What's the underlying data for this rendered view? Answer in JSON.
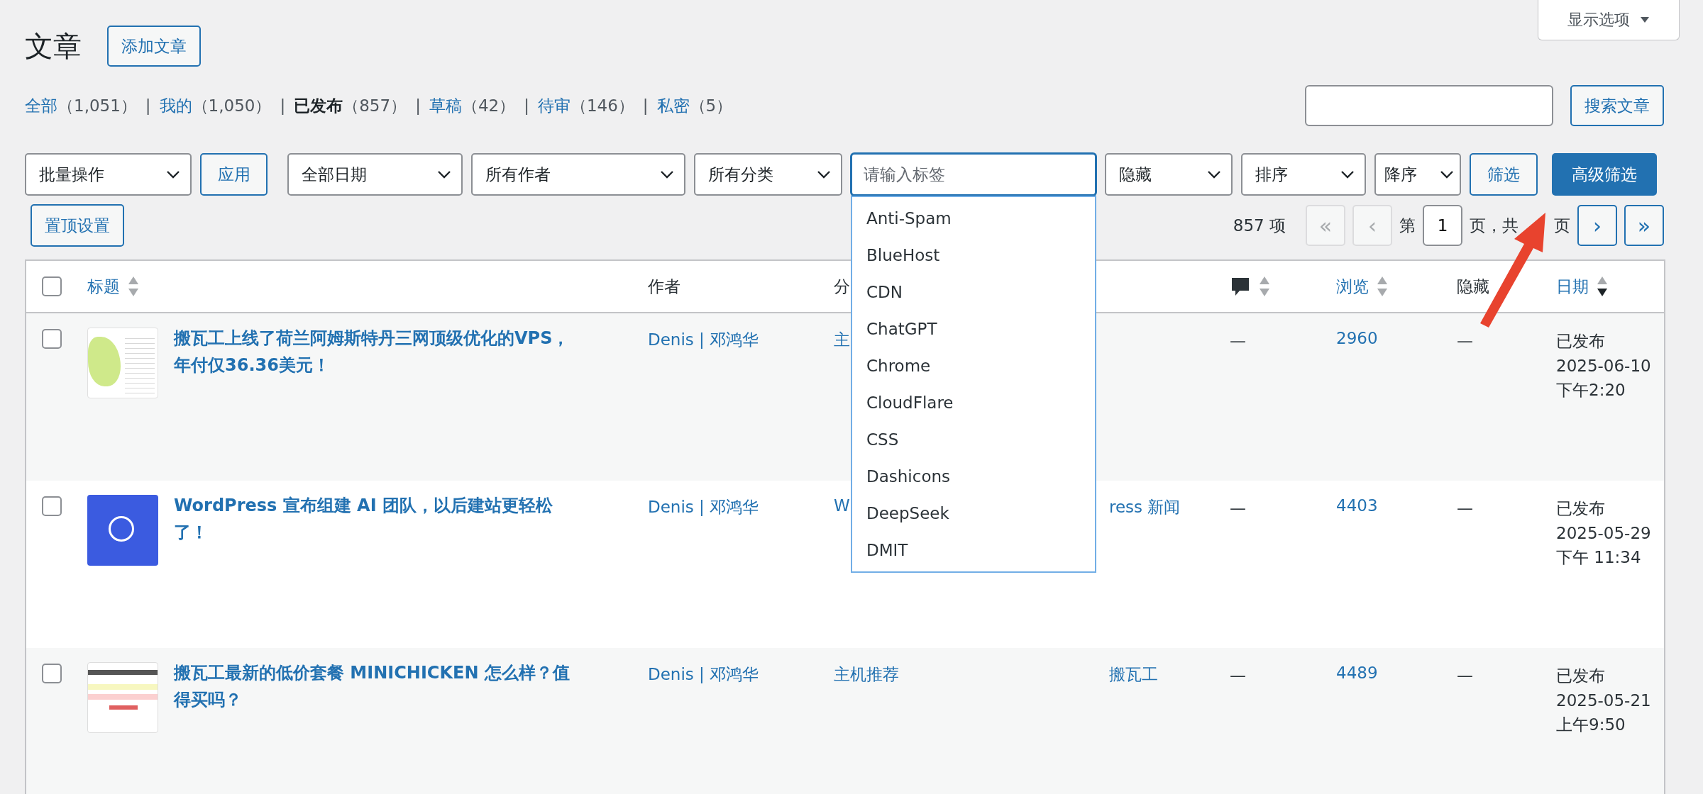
{
  "header": {
    "title": "文章",
    "add_button": "添加文章",
    "screen_options": "显示选项"
  },
  "status_links": [
    {
      "label": "全部",
      "count": "（1,051）",
      "separator": "|",
      "selected": false
    },
    {
      "label": "我的",
      "count": "（1,050）",
      "separator": "|",
      "selected": false
    },
    {
      "label": "已发布",
      "count": "（857）",
      "separator": "|",
      "selected": true
    },
    {
      "label": "草稿",
      "count": "（42）",
      "separator": "|",
      "selected": false
    },
    {
      "label": "待审",
      "count": "（146）",
      "separator": "|",
      "selected": false
    },
    {
      "label": "私密",
      "count": "（5）",
      "selected": false
    }
  ],
  "search": {
    "button": "搜索文章"
  },
  "filters": [
    {
      "kind": "select",
      "value": "批量操作"
    },
    {
      "kind": "button",
      "label": "应用"
    },
    {
      "kind": "select",
      "value": "全部日期"
    },
    {
      "kind": "select",
      "value": "所有作者"
    },
    {
      "kind": "select",
      "value": "所有分类"
    },
    {
      "kind": "tag_input",
      "placeholder": "请输入标签",
      "suggestions": [
        "Anti-Spam",
        "BlueHost",
        "CDN",
        "ChatGPT",
        "Chrome",
        "CloudFlare",
        "CSS",
        "Dashicons",
        "DeepSeek",
        "DMIT"
      ]
    },
    {
      "kind": "select",
      "value": "隐藏"
    },
    {
      "kind": "select",
      "value": "排序"
    },
    {
      "kind": "select",
      "value": "降序"
    },
    {
      "kind": "button",
      "label": "筛选"
    },
    {
      "kind": "primary",
      "label": "高级筛选"
    }
  ],
  "sticky_button": "置顶设置",
  "pagination": {
    "count": "857 项",
    "buttons_before": [
      {
        "label": "«",
        "disabled": true
      },
      {
        "label": "‹",
        "disabled": true
      }
    ],
    "page_label": "第",
    "page": "1",
    "of_label": "页，共",
    "page_suffix": "页",
    "buttons_after": [
      {
        "label": "›",
        "disabled": false
      },
      {
        "label": "»",
        "disabled": false
      }
    ]
  },
  "table": {
    "columns": [
      {
        "kind": "checkbox",
        "checked": false
      },
      {
        "kind": "text",
        "label": "标题",
        "link": true,
        "sortable": true,
        "sorted_desc": false
      },
      {
        "kind": "text",
        "label": "作者",
        "link": false,
        "sortable": false
      },
      {
        "kind": "text",
        "label": "分",
        "link": false,
        "sortable": false
      },
      {
        "kind": "empty"
      },
      {
        "kind": "comment_icon",
        "sortable": true,
        "sorted_desc": false
      },
      {
        "kind": "text",
        "label": "浏览",
        "link": true,
        "sortable": true,
        "sorted_desc": false
      },
      {
        "kind": "text",
        "label": "隐藏",
        "link": false,
        "sortable": false
      },
      {
        "kind": "text",
        "label": "日期",
        "link": true,
        "sortable": true,
        "sorted_desc": true
      }
    ],
    "rows": [
      {
        "checked": false,
        "thumbnail": {
          "kind": "map"
        },
        "title": "搬瓦工上线了荷兰阿姆斯特丹三网顶级优化的VPS，年付仅36.36美元！",
        "author": "Denis | 邓鸿华",
        "category": "主",
        "tags": "",
        "comments": "—",
        "views": "2960",
        "hidden": "—",
        "status": "已发布",
        "date": "2025-06-10 下午2:20"
      },
      {
        "checked": false,
        "thumbnail": {
          "kind": "blue"
        },
        "title": "WordPress 宣布组建 AI 团队，以后建站更轻松了！",
        "author": "Denis | 邓鸿华",
        "category": "W",
        "tags": "ress 新闻",
        "comments": "—",
        "views": "4403",
        "hidden": "—",
        "status": "已发布",
        "date": "2025-05-29 下午 11:34"
      },
      {
        "checked": false,
        "thumbnail": {
          "kind": "table"
        },
        "title": "搬瓦工最新的低价套餐 MINICHICKEN 怎么样？值得买吗？",
        "author": "Denis | 邓鸿华",
        "category": "主机推荐",
        "tags": "搬瓦工",
        "comments": "—",
        "views": "4489",
        "hidden": "—",
        "status": "已发布",
        "date": "2025-05-21 上午9:50"
      }
    ]
  }
}
